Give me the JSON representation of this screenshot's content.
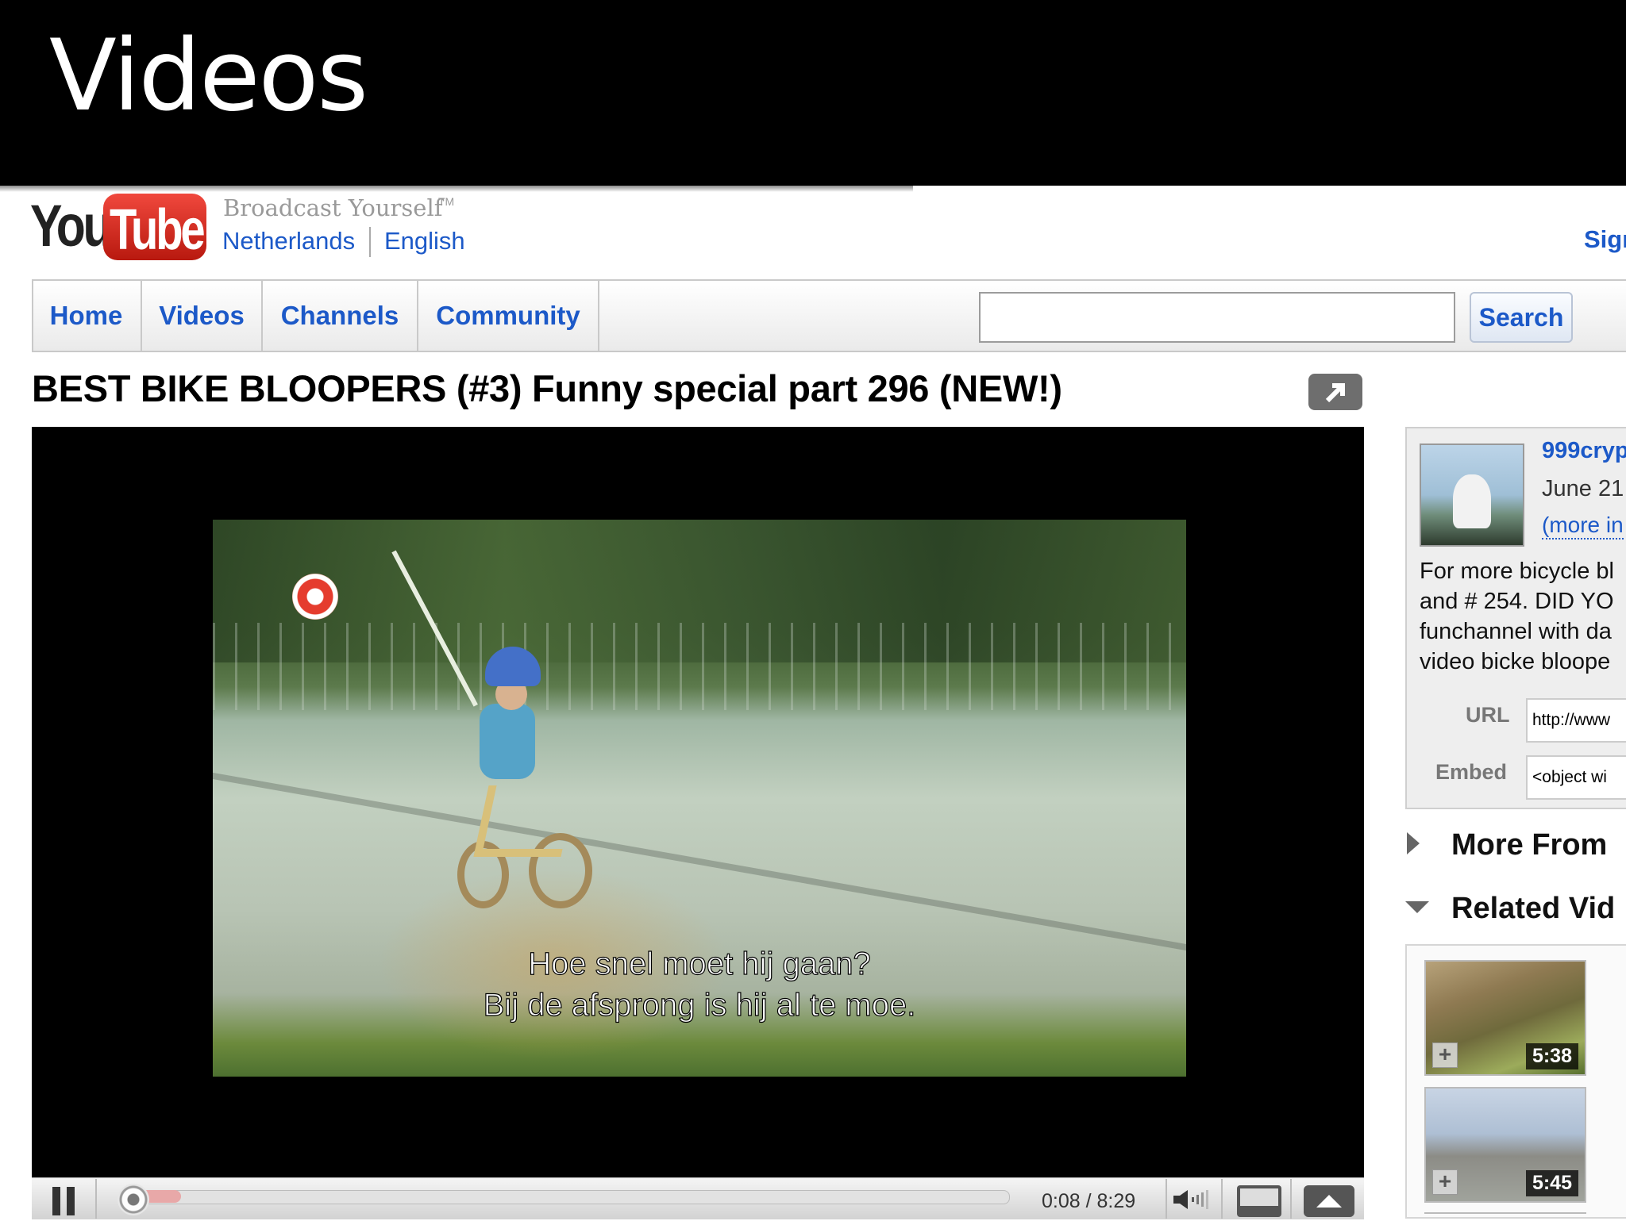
{
  "slide": {
    "title": "Videos"
  },
  "header": {
    "logo_you": "You",
    "logo_tube": "Tube",
    "tagline": "Broadcast Yourself",
    "tagline_tm": "TM",
    "country": "Netherlands",
    "language": "English",
    "sign_in": "Sign"
  },
  "nav": {
    "tabs": [
      {
        "label": "Home"
      },
      {
        "label": "Videos"
      },
      {
        "label": "Channels"
      },
      {
        "label": "Community"
      }
    ],
    "search_value": "",
    "search_button": "Search"
  },
  "video": {
    "title": "BEST BIKE BLOOPERS (#3) Funny special part 296 (NEW!)",
    "subtitle_line1": "Hoe snel moet hij gaan?",
    "subtitle_line2": "Bij de afsprong is hij al te moe.",
    "current_time": "0:08",
    "duration": "8:29",
    "time_display": "0:08 / 8:29",
    "played_fraction": 0.016,
    "loaded_fraction": 0.07
  },
  "info": {
    "channel_name": "999cryp",
    "upload_date": "June 21",
    "more_info": "(more in",
    "description_lines": [
      "For more bicycle bl",
      "and # 254. DID YO",
      "funchannel with da",
      "video bicke bloope"
    ],
    "url_label": "URL",
    "url_value": "http://www",
    "embed_label": "Embed",
    "embed_value": "<object wi"
  },
  "sections": {
    "more_from": "More From",
    "related": "Related Vid"
  },
  "related": [
    {
      "duration": "5:38"
    },
    {
      "duration": "5:45"
    }
  ],
  "colors": {
    "link_blue": "#1c59c8",
    "youtube_red": "#d8261b",
    "progress_red": "#cc2222"
  }
}
